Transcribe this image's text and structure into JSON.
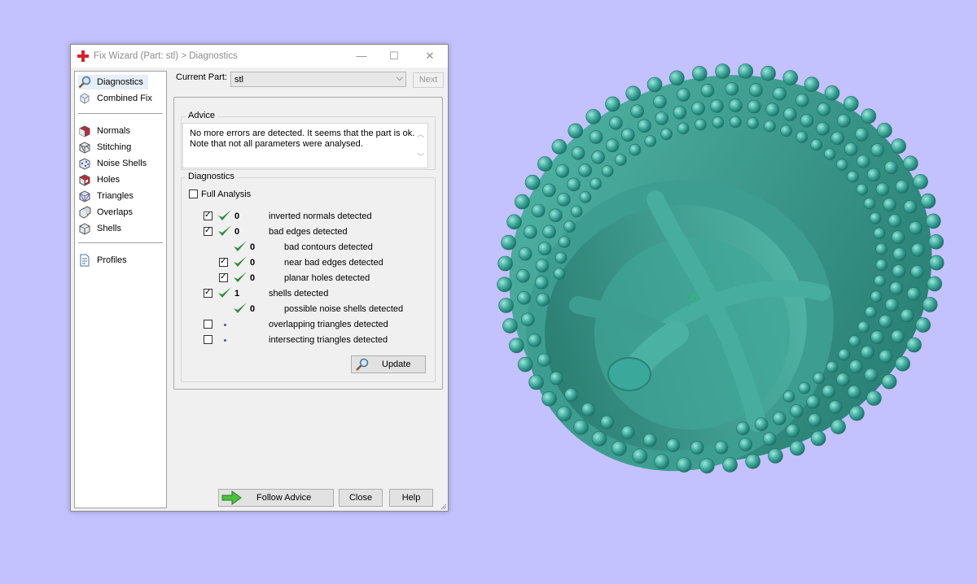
{
  "window": {
    "title": "Fix Wizard (Part: stl) > Diagnostics",
    "controls": {
      "minimize": "—",
      "maximize": "☐",
      "close": "✕"
    }
  },
  "sidebar": {
    "items": [
      {
        "label": "Diagnostics",
        "icon": "magnifier-icon",
        "selected": true
      },
      {
        "label": "Combined Fix",
        "icon": "combined-fix-icon"
      },
      {
        "label": "Normals",
        "icon": "normals-icon"
      },
      {
        "label": "Stitching",
        "icon": "stitching-icon"
      },
      {
        "label": "Noise Shells",
        "icon": "noise-shells-icon"
      },
      {
        "label": "Holes",
        "icon": "holes-icon"
      },
      {
        "label": "Triangles",
        "icon": "triangles-icon"
      },
      {
        "label": "Overlaps",
        "icon": "overlaps-icon"
      },
      {
        "label": "Shells",
        "icon": "shells-icon"
      },
      {
        "label": "Profiles",
        "icon": "profiles-icon"
      }
    ]
  },
  "current_part": {
    "label": "Current Part:",
    "value": "stl"
  },
  "next_label": "Next",
  "advice": {
    "title": "Advice",
    "lines": [
      "No more errors are detected. It seems that the part is ok.",
      "Note that not all parameters were analysed."
    ]
  },
  "diagnostics": {
    "title": "Diagnostics",
    "full_analysis_label": "Full Analysis",
    "full_analysis_checked": false,
    "rows": [
      {
        "checked": true,
        "status": "ok",
        "count": "0",
        "label": "inverted normals detected",
        "indent": 0
      },
      {
        "checked": true,
        "status": "ok",
        "count": "0",
        "label": "bad edges detected",
        "indent": 0
      },
      {
        "checked": null,
        "status": "ok",
        "count": "0",
        "label": "bad contours detected",
        "indent": 1
      },
      {
        "checked": true,
        "status": "ok",
        "count": "0",
        "label": "near bad edges detected",
        "indent": 1
      },
      {
        "checked": true,
        "status": "ok",
        "count": "0",
        "label": "planar holes detected",
        "indent": 1
      },
      {
        "checked": true,
        "status": "ok",
        "count": "1",
        "label": "shells detected",
        "indent": 0
      },
      {
        "checked": null,
        "status": "ok",
        "count": "0",
        "label": "possible noise shells detected",
        "indent": 1
      },
      {
        "checked": false,
        "status": "pending",
        "count": "",
        "label": "overlapping triangles detected",
        "indent": 0
      },
      {
        "checked": false,
        "status": "pending",
        "count": "",
        "label": "intersecting triangles detected",
        "indent": 0
      }
    ],
    "update_label": "Update"
  },
  "buttons": {
    "follow_advice": "Follow Advice",
    "close": "Close",
    "help": "Help"
  },
  "colors": {
    "background": "#c3c1fe",
    "model": "#3aa89a",
    "check_green": "#2e8b3a",
    "pending_dot": "#3557c6"
  }
}
